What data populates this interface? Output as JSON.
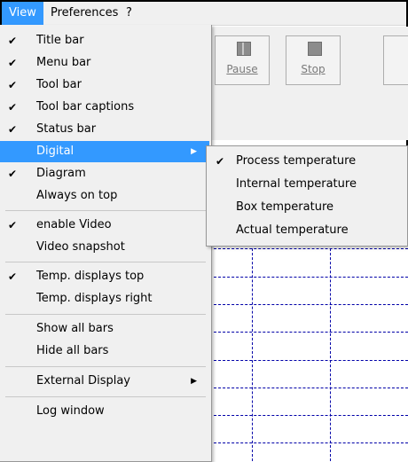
{
  "menubar": {
    "items": [
      {
        "label": "View"
      },
      {
        "label": "Preferences"
      },
      {
        "label": "?"
      }
    ]
  },
  "toolbar": {
    "pause_label": "Pause",
    "stop_label": "Stop"
  },
  "view_menu": {
    "check_glyph": "✔",
    "submenu_arrow": "▶",
    "items": [
      {
        "label": "Title bar",
        "checked": true
      },
      {
        "label": "Menu bar",
        "checked": true
      },
      {
        "label": "Tool bar",
        "checked": true
      },
      {
        "label": "Tool bar captions",
        "checked": true
      },
      {
        "label": "Status bar",
        "checked": true
      },
      {
        "label": "Digital",
        "checked": false,
        "submenu": true,
        "highlighted": true
      },
      {
        "label": "Diagram",
        "checked": true
      },
      {
        "label": "Always on top",
        "checked": false
      },
      {
        "label": "enable Video",
        "checked": true
      },
      {
        "label": "Video snapshot",
        "checked": false
      },
      {
        "label": "Temp. displays top",
        "checked": true
      },
      {
        "label": "Temp. displays right",
        "checked": false
      },
      {
        "label": "Show all bars",
        "checked": false
      },
      {
        "label": "Hide all bars",
        "checked": false
      },
      {
        "label": "External Display",
        "checked": false,
        "submenu": true
      },
      {
        "label": "Log window",
        "checked": false
      }
    ]
  },
  "digital_submenu": {
    "items": [
      {
        "label": "Process temperature",
        "checked": true
      },
      {
        "label": "Internal temperature",
        "checked": false
      },
      {
        "label": "Box temperature",
        "checked": false
      },
      {
        "label": "Actual temperature",
        "checked": false
      }
    ]
  },
  "colors": {
    "highlight": "#3399ff",
    "menu_bg": "#f0f0f0",
    "grid_line": "#0000a8"
  }
}
